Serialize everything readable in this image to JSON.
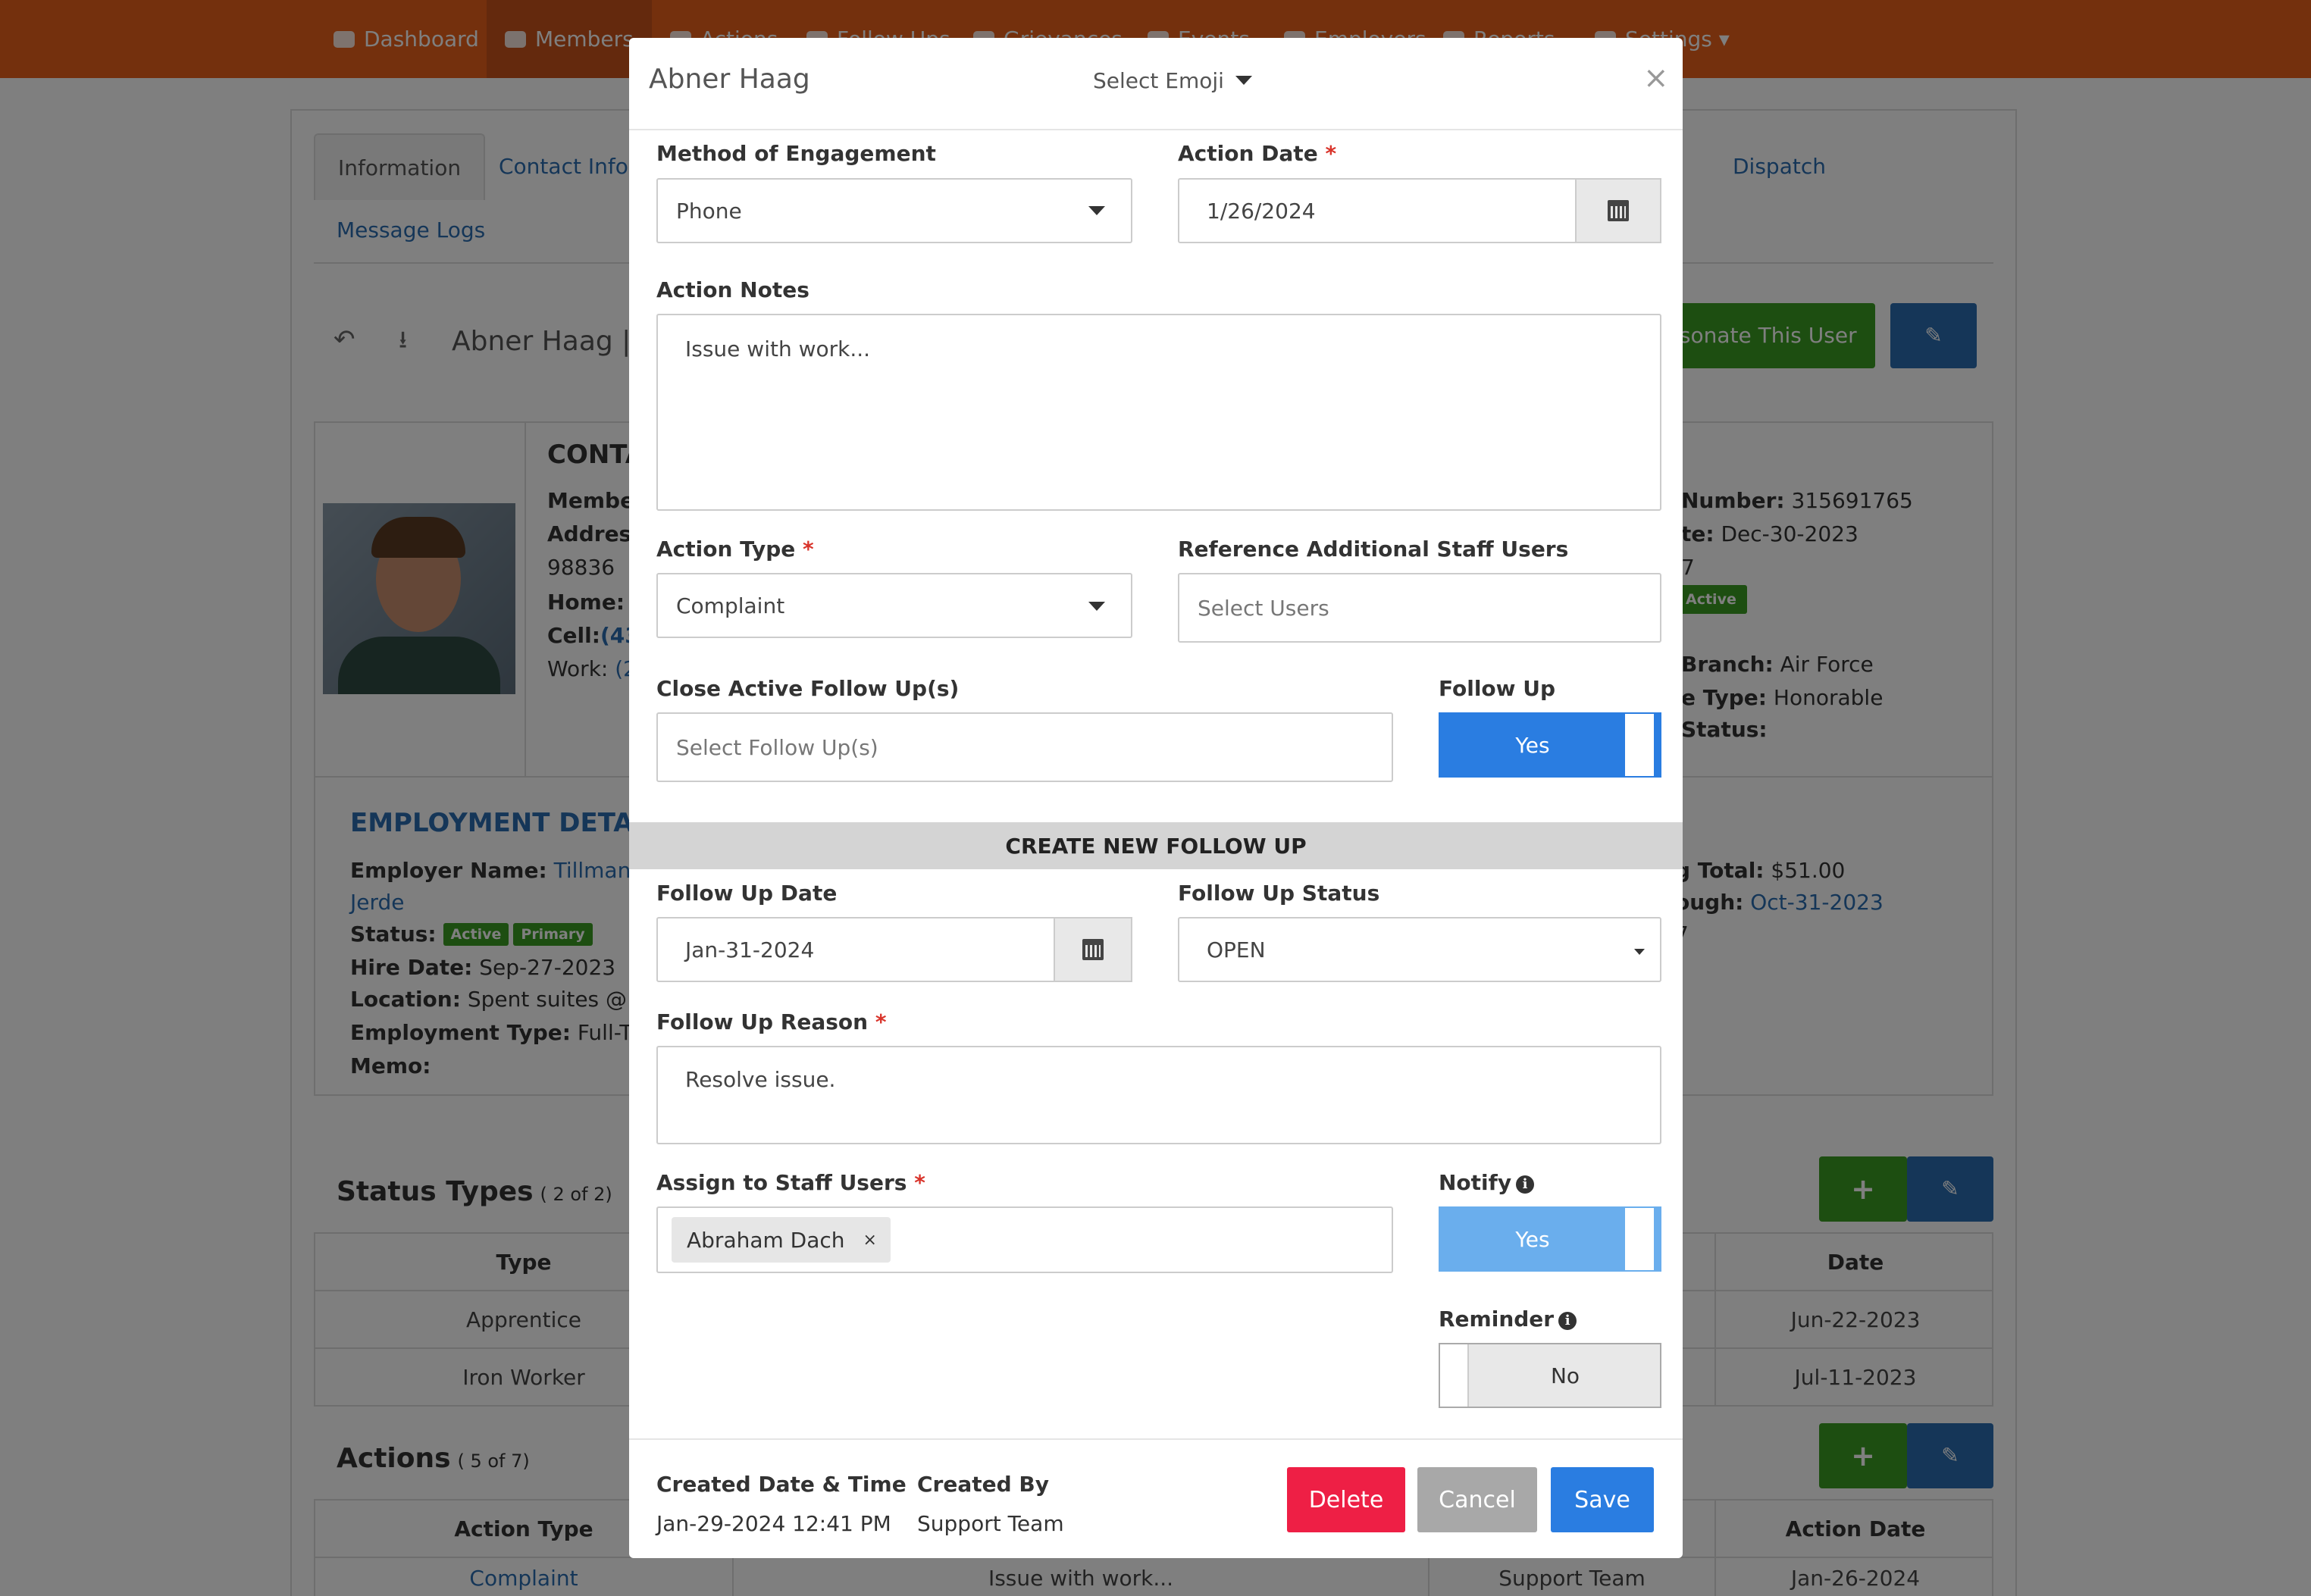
{
  "nav": {
    "items": [
      "Dashboard",
      "Members",
      "Actions",
      "Follow Ups",
      "Grievances",
      "Events",
      "Employers",
      "Reports",
      "Settings"
    ]
  },
  "page": {
    "tabs": [
      "Information",
      "Contact Info",
      "Dispatch",
      "Message Logs"
    ],
    "member_title": "Abner Haag | M",
    "impersonate_label": "rsonate This User",
    "contact_heading": "CONTA",
    "contact": {
      "member_label": "Member",
      "address_label": "Address",
      "zip": "98836",
      "home_label": "Home:",
      "home_value": "a",
      "cell_label": "Cell:",
      "cell_value": "(438",
      "work_label": "Work:",
      "work_value": "(2"
    },
    "right_info": {
      "number_label": "Number:",
      "number_value": "315691765",
      "date_label": "te:",
      "date_value": "Dec-30-2023",
      "frag_7": "7",
      "active_badge": "Active",
      "branch_label": "Branch:",
      "branch_value": "Air Force",
      "type_label": "e Type:",
      "type_value": "Honorable",
      "status_label": "Status:"
    },
    "employment": {
      "heading": "EMPLOYMENT DETAILS",
      "employer_label": "Employer Name:",
      "employer_value": "Tillman, Wo",
      "employer_value2": "Jerde",
      "status_label": "Status:",
      "badges": [
        "Active",
        "Primary"
      ],
      "hire_label": "Hire Date:",
      "hire_value": "Sep-27-2023",
      "location_label": "Location:",
      "location_value": "Spent suites @ cent",
      "emp_type_label": "Employment Type:",
      "emp_type_value": "Full-Time",
      "memo_label": "Memo:"
    },
    "dues": {
      "total_label": "g Total:",
      "total_value": "$51.00",
      "through_label": "ough:",
      "through_value": "Oct-31-2023",
      "frag": "7"
    },
    "status_types": {
      "title": "Status Types",
      "count": "( 2 of 2)",
      "col_type": "Type",
      "col_date": "Date",
      "rows": [
        {
          "type": "Apprentice",
          "date": "Jun-22-2023"
        },
        {
          "type": "Iron Worker",
          "date": "Jul-11-2023"
        }
      ]
    },
    "actions": {
      "title": "Actions",
      "count": "( 5 of 7)",
      "col_type": "Action Type",
      "col_date": "Action Date",
      "row": {
        "type": "Complaint",
        "notes": "Issue with work...",
        "staff": "Support Team",
        "date": "Jan-26-2024"
      }
    }
  },
  "modal": {
    "title": "Abner Haag",
    "emoji_select": "Select Emoji",
    "close": "×",
    "method_label": "Method of Engagement",
    "method_value": "Phone",
    "action_date_label": "Action Date",
    "action_date_value": "1/26/2024",
    "notes_label": "Action Notes",
    "notes_value": "Issue with work...",
    "action_type_label": "Action Type",
    "action_type_value": "Complaint",
    "ref_staff_label": "Reference Additional Staff Users",
    "ref_staff_placeholder": "Select Users",
    "close_followups_label": "Close Active Follow Up(s)",
    "close_followups_placeholder": "Select Follow Up(s)",
    "follow_up_label": "Follow Up",
    "follow_up_value": "Yes",
    "section_header": "CREATE NEW FOLLOW UP",
    "fu_date_label": "Follow Up Date",
    "fu_date_value": "Jan-31-2024",
    "fu_status_label": "Follow Up Status",
    "fu_status_value": "OPEN",
    "fu_reason_label": "Follow Up Reason",
    "fu_reason_value": "Resolve issue.",
    "assign_label": "Assign to Staff Users",
    "assign_tag": "Abraham Dach",
    "assign_tag_remove": "×",
    "notify_label": "Notify",
    "notify_value": "Yes",
    "reminder_label": "Reminder",
    "reminder_value": "No",
    "created_date_label": "Created Date & Time",
    "created_date_value": "Jan-29-2024 12:41 PM",
    "created_by_label": "Created By",
    "created_by_value": "Support Team",
    "delete_label": "Delete",
    "cancel_label": "Cancel",
    "save_label": "Save",
    "req_mark": "*",
    "info_mark": "i"
  },
  "colors": {
    "nav_orange": "#e8611a",
    "green": "#3a9d23",
    "blue": "#2a6db0",
    "toggle_blue": "#2a7de1",
    "delete_red": "#ee1f45",
    "cancel_gray": "#a8a8a8"
  }
}
